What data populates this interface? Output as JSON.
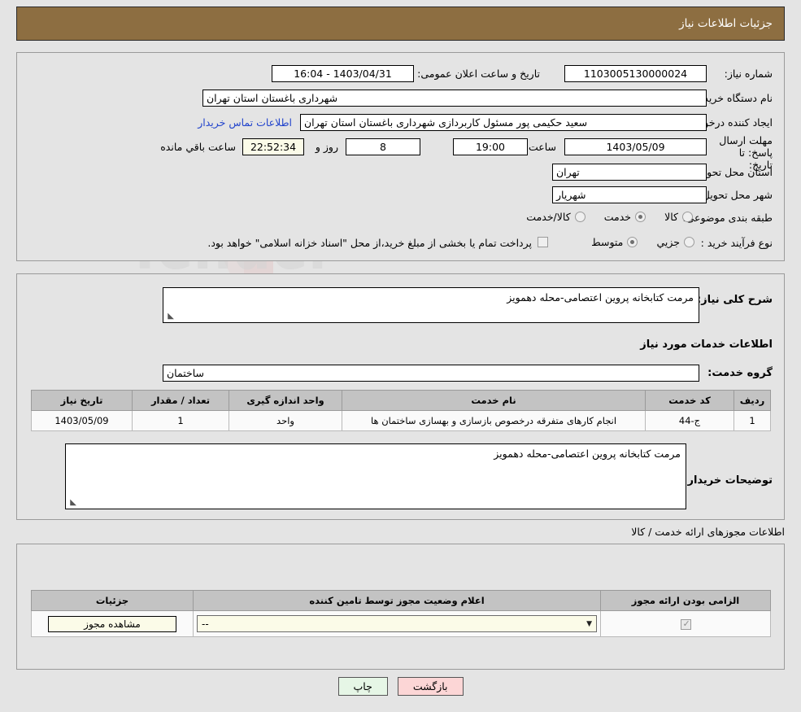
{
  "header": {
    "title": "جزئیات اطلاعات نیاز"
  },
  "watermark": {
    "text": "AriaTender.net"
  },
  "need_info": {
    "need_number_label": "شماره نیاز:",
    "need_number_value": "1103005130000024",
    "announce_datetime_label": "تاریخ و ساعت اعلان عمومی:",
    "announce_datetime_value": "1403/04/31 - 16:04",
    "buyer_org_label": "نام دستگاه خریدار:",
    "buyer_org_value": "شهرداری باغستان استان تهران",
    "requester_label": "ایجاد کننده درخواست:",
    "requester_value": "سعید حکیمی پور مسئول کاربردازی شهرداری باغستان استان تهران",
    "contact_link": "اطلاعات تماس خریدار",
    "deadline_label": "مهلت ارسال پاسخ: تا تاریخ:",
    "deadline_date": "1403/05/09",
    "hour_label": "ساعت",
    "deadline_time": "19:00",
    "days_remaining": "8",
    "days_unit_label": "روز و",
    "time_remaining": "22:52:34",
    "remaining_suffix_label": "ساعت باقي مانده",
    "province_label": "استان محل تحویل:",
    "province_value": "تهران",
    "city_label": "شهر محل تحویل:",
    "city_value": "شهریار",
    "category_label": "طبقه بندی موضوعی:",
    "category_options": [
      {
        "label": "کالا",
        "selected": false
      },
      {
        "label": "خدمت",
        "selected": true
      },
      {
        "label": "کالا/خدمت",
        "selected": false
      }
    ],
    "process_label": "نوع فرآیند خرید :",
    "process_options": [
      {
        "label": "جزیي",
        "selected": false
      },
      {
        "label": "متوسط",
        "selected": true
      }
    ],
    "treasury_checkbox_checked": false,
    "treasury_note": "پرداخت تمام یا بخشی از مبلغ خرید،از محل \"اسناد خزانه اسلامی\" خواهد بود."
  },
  "need_detail": {
    "general_desc_label": "شرح کلی نیاز:",
    "general_desc_value": "مرمت کتابخانه پروین اعتصامی-محله دهمویز",
    "services_section_title": "اطلاعات خدمات مورد نیاز",
    "service_group_label": "گروه خدمت:",
    "service_group_value": "ساختمان",
    "table": {
      "headers": [
        "ردیف",
        "کد خدمت",
        "نام خدمت",
        "واحد اندازه گیری",
        "تعداد / مقدار",
        "تاریخ نیاز"
      ],
      "rows": [
        [
          "1",
          "ج-44",
          "انجام کارهای متفرقه درخصوص بازسازی و بهسازی ساختمان ها",
          "واحد",
          "1",
          "1403/05/09"
        ]
      ]
    },
    "buyer_notes_label": "توضیحات خریدار:",
    "buyer_notes_value": "مرمت کتابخانه پروین اعتصامی-محله دهمویز"
  },
  "licenses": {
    "section_title": "اطلاعات مجوزهای ارائه خدمت / کالا",
    "table": {
      "headers": [
        "الزامی بودن ارائه مجوز",
        "اعلام وضعیت مجوز توسط تامین کننده",
        "جزئیات"
      ],
      "rows": [
        {
          "required_checked": true,
          "status_value": "--",
          "detail_button": "مشاهده مجوز"
        }
      ]
    }
  },
  "footer": {
    "print_button": "چاپ",
    "back_button": "بازگشت"
  },
  "colors": {
    "header_bg": "#8d6e41",
    "page_bg": "#e4e4e4",
    "link": "#2244cc",
    "table_header_bg": "#c3c3c3",
    "print_button_bg": "#e6f6e6",
    "back_button_bg": "#fcd6d6",
    "select_bg": "#fbfbe8"
  }
}
